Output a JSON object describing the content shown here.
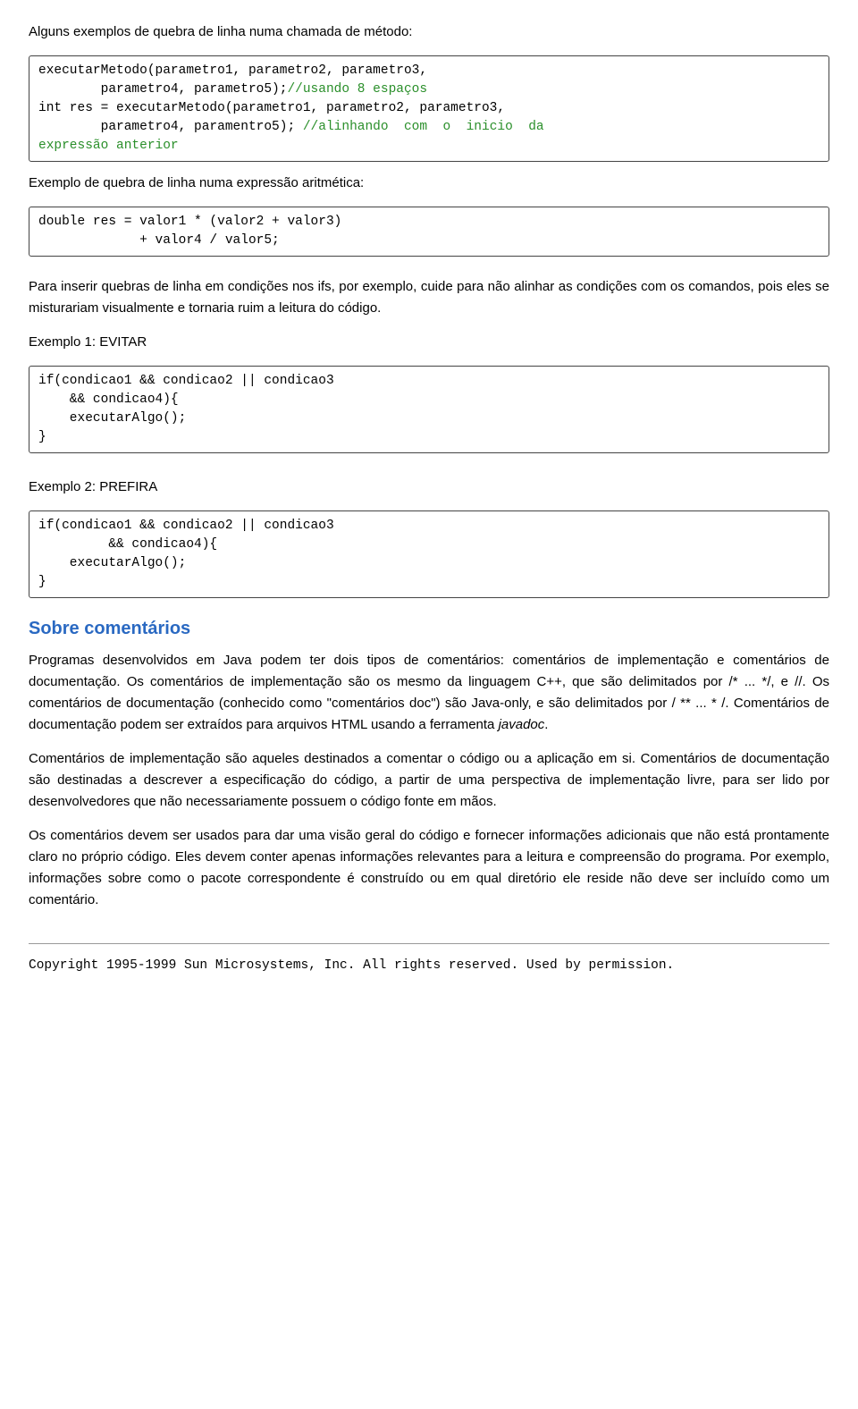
{
  "p_intro": "Alguns exemplos de quebra de linha numa chamada de método:",
  "code1": {
    "l1a": "executarMetodo(parametro1, parametro2, parametro3,",
    "l2a": "        parametro4, parametro5);",
    "l2b": "//usando 8 espaços",
    "l3a": "int res = executarMetodo(parametro1, parametro2, parametro3,",
    "l4a": "        parametro4, paramentro5); ",
    "l4b": "//alinhando  com  o  inicio  da",
    "l5b": "expressão anterior"
  },
  "p_ex_expr": "Exemplo de quebra de linha numa expressão aritmética:",
  "code2": {
    "l1": "double res = valor1 * (valor2 + valor3)",
    "l2": "             + valor4 / valor5;"
  },
  "p_quebras": "Para inserir quebras de linha em condições nos ifs, por exemplo, cuide para não alinhar as condições com os comandos, pois eles se misturariam visualmente e tornaria ruim a leitura do código.",
  "p_evitar": "Exemplo 1: EVITAR",
  "code3": {
    "l1": "if(condicao1 && condicao2 || condicao3",
    "l2": "    && condicao4){",
    "l3": "    executarAlgo();",
    "l4": "}"
  },
  "p_prefira": "Exemplo 2: PREFIRA",
  "code4": {
    "l1": "if(condicao1 && condicao2 || condicao3",
    "l2": "         && condicao4){",
    "l3": "    executarAlgo();",
    "l4": "}"
  },
  "h_coment": "Sobre comentários",
  "p_c1a": "Programas desenvolvidos em Java podem ter dois tipos de comentários: comentários de implementação e comentários de documentação. Os comentários de implementação são os mesmo da linguagem C++, que são delimitados por /* ... */, e //. Os comentários de documentação (conhecido como \"comentários doc\") são Java-only, e são delimitados por / ** ... * /. Comentários de documentação podem ser extraídos para arquivos HTML usando a ferramenta ",
  "p_c1b": "javadoc",
  "p_c1c": ".",
  "p_c2": "Comentários de implementação são aqueles destinados a comentar o código ou a aplicação em si. Comentários de documentação são destinadas a descrever a especificação do código, a partir de uma perspectiva de implementação livre, para ser lido por desenvolvedores que não necessariamente possuem o código fonte em mãos.",
  "p_c3": "Os comentários devem ser usados para dar uma visão geral do código e fornecer informações adicionais que não está prontamente claro no próprio código. Eles devem conter apenas informações relevantes para a leitura e compreensão do programa. Por exemplo, informações sobre como o pacote correspondente é construído ou em qual diretório ele reside não deve ser incluído como um comentário.",
  "footer": "Copyright 1995-1999 Sun Microsystems, Inc. All rights reserved. Used by permission."
}
